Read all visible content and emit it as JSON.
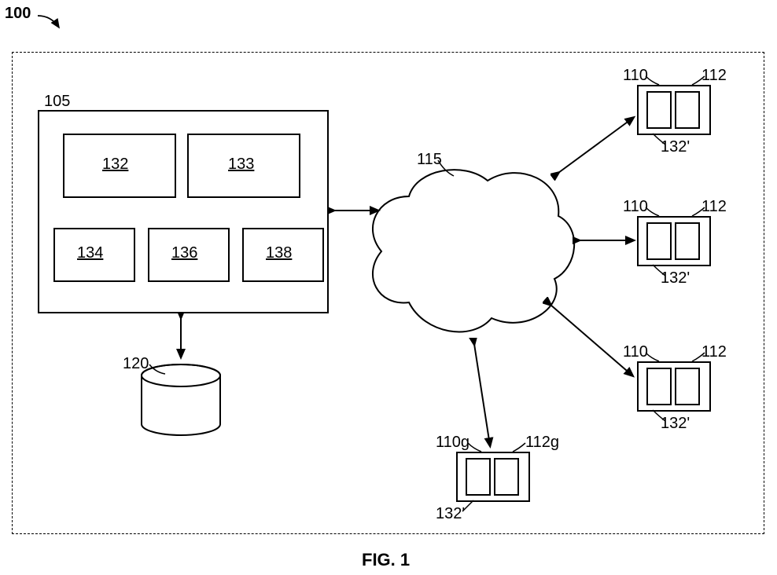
{
  "figure": {
    "overall_ref": "100",
    "title": "FIG. 1",
    "main_box_ref": "105",
    "database_ref": "120",
    "cloud_ref": "115",
    "modules": {
      "m132": "132",
      "m133": "133",
      "m134": "134",
      "m136": "136",
      "m138": "138"
    },
    "client_upper": {
      "left": "110",
      "right": "112"
    },
    "client_g": {
      "left": "110g",
      "right": "112g"
    },
    "client_sub_ref": "132'"
  }
}
